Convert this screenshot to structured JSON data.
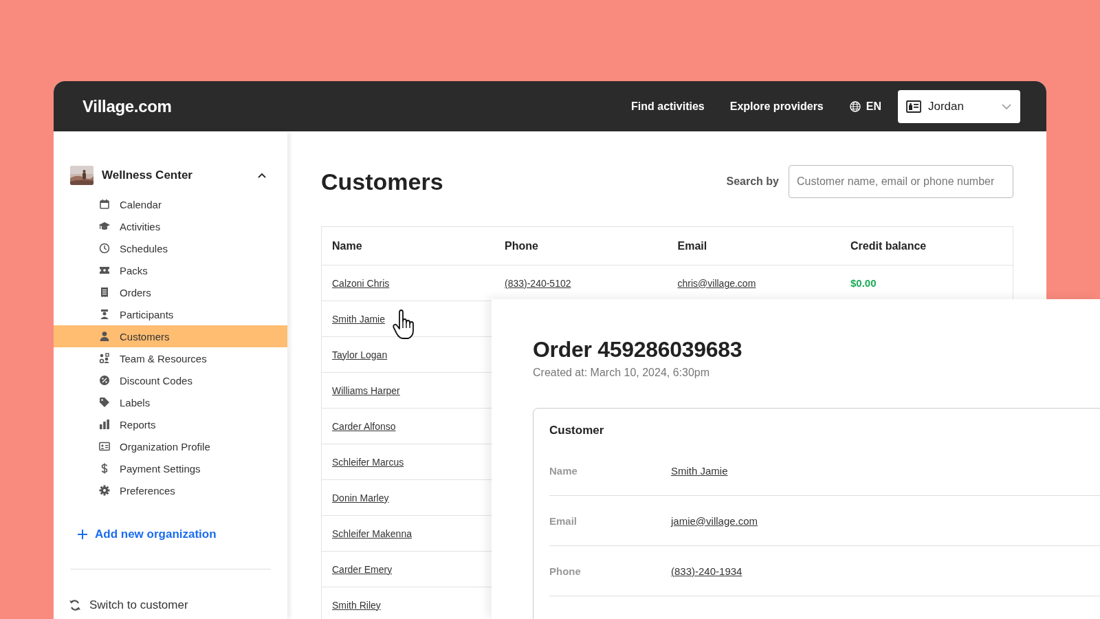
{
  "header": {
    "logo": "Village.com",
    "nav": [
      "Find activities",
      "Explore providers"
    ],
    "language": "EN",
    "user": "Jordan"
  },
  "sidebar": {
    "organization": {
      "name": "Wellness Center",
      "expanded": true
    },
    "items": [
      {
        "label": "Calendar",
        "selected": false
      },
      {
        "label": "Activities",
        "selected": false
      },
      {
        "label": "Schedules",
        "selected": false
      },
      {
        "label": "Packs",
        "selected": false
      },
      {
        "label": "Orders",
        "selected": false
      },
      {
        "label": "Participants",
        "selected": false
      },
      {
        "label": "Customers",
        "selected": true
      },
      {
        "label": "Team & Resources",
        "selected": false
      },
      {
        "label": "Discount Codes",
        "selected": false
      },
      {
        "label": "Labels",
        "selected": false
      },
      {
        "label": "Reports",
        "selected": false
      },
      {
        "label": "Organization Profile",
        "selected": false
      },
      {
        "label": "Payment Settings",
        "selected": false
      },
      {
        "label": "Preferences",
        "selected": false
      }
    ],
    "add_link": "Add new organization",
    "switch_link": "Switch to customer"
  },
  "page": {
    "title": "Customers",
    "search": {
      "label": "Search by",
      "placeholder": "Customer name, email or phone number"
    }
  },
  "table": {
    "columns": [
      {
        "label": "Name",
        "kind": "link"
      },
      {
        "label": "Phone",
        "kind": "link"
      },
      {
        "label": "Email",
        "kind": "link"
      },
      {
        "label": "Credit balance",
        "kind": "amount"
      }
    ],
    "rows": [
      [
        "Calzoni Chris",
        "(833)-240-5102",
        "chris@village.com",
        "$0.00"
      ],
      [
        "Smith Jamie"
      ],
      [
        "Taylor Logan"
      ],
      [
        "Williams Harper"
      ],
      [
        "Carder Alfonso"
      ],
      [
        "Schleifer Marcus"
      ],
      [
        "Donin Marley"
      ],
      [
        "Schleifer Makenna"
      ],
      [
        "Carder Emery"
      ],
      [
        "Smith Riley"
      ]
    ]
  },
  "order": {
    "title": "Order 459286039683",
    "created": "Created at: March 10, 2024, 6:30pm",
    "section": "Customer",
    "fields": [
      {
        "label": "Name",
        "value": "Smith Jamie"
      },
      {
        "label": "Email",
        "value": "jamie@village.com"
      },
      {
        "label": "Phone",
        "value": "(833)-240-1934"
      }
    ]
  }
}
